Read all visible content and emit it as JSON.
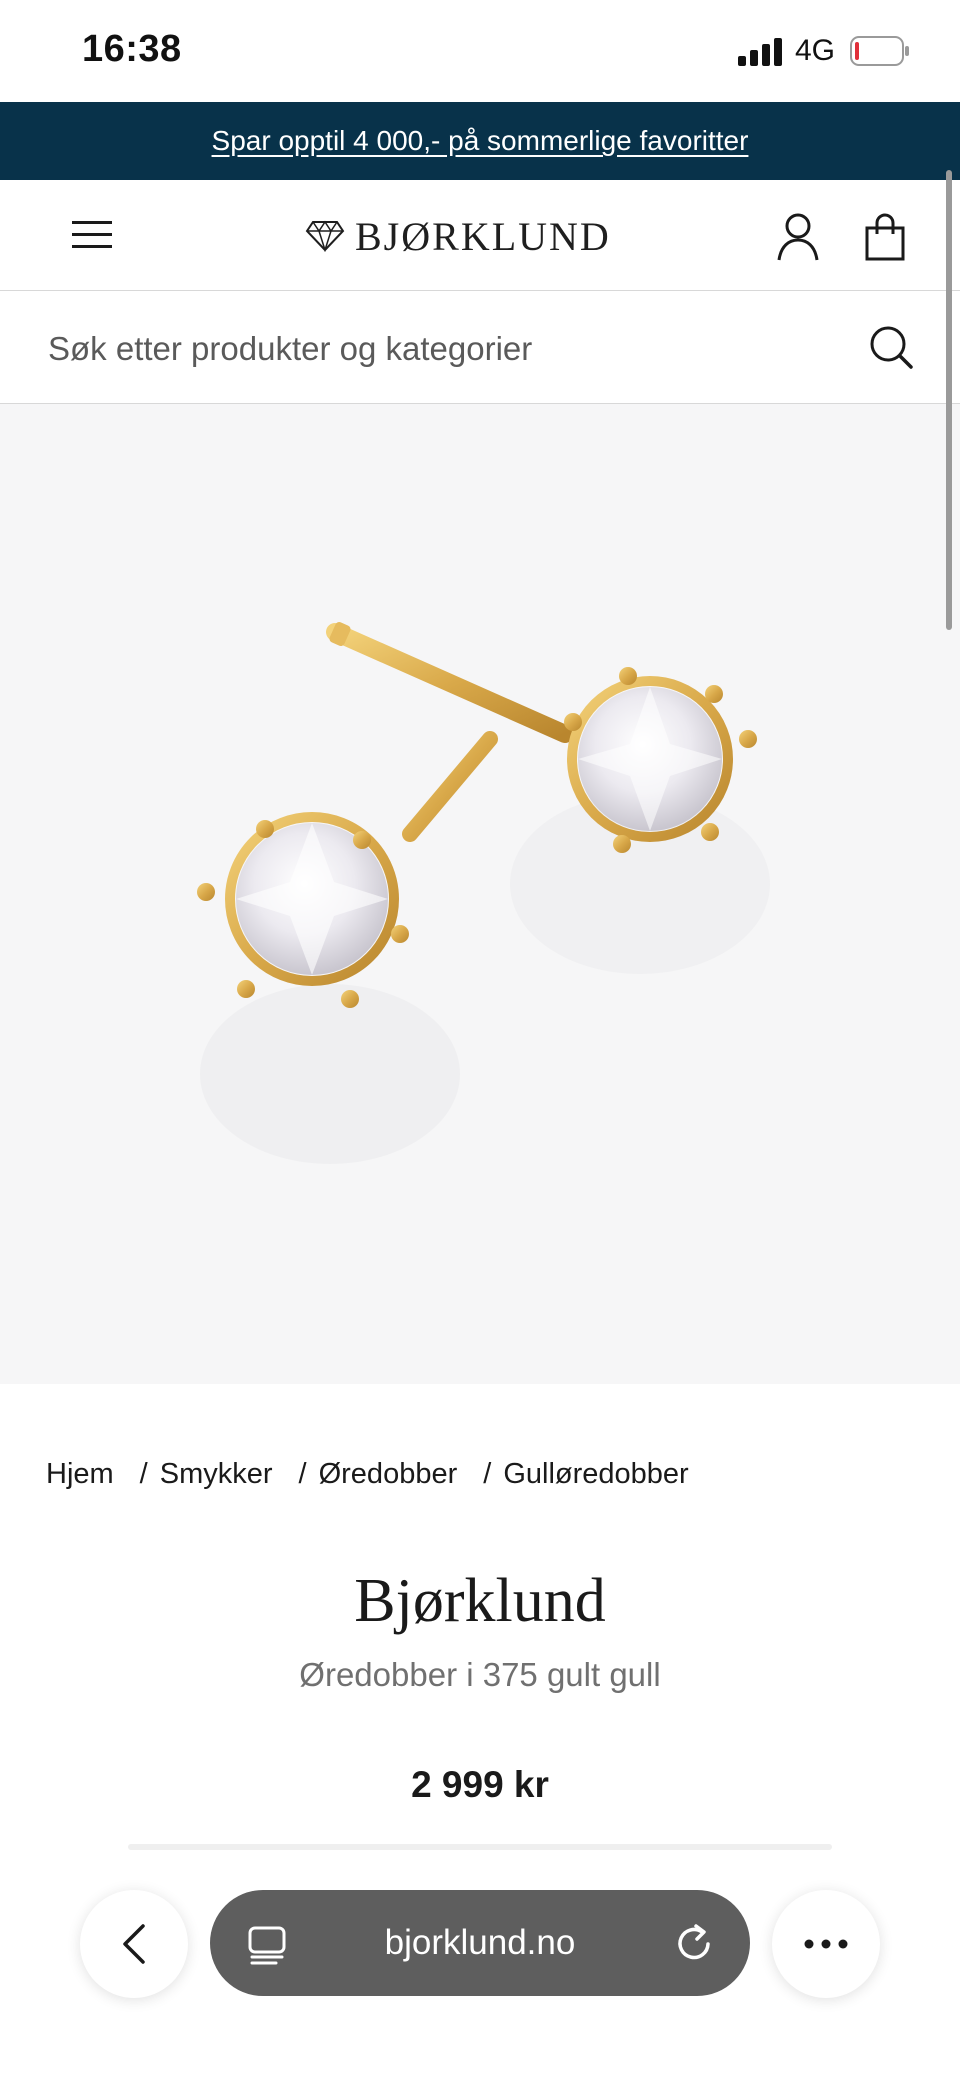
{
  "status_bar": {
    "time": "16:38",
    "network": "4G",
    "battery_icon": "battery-low-icon",
    "signal_icon": "cellular-signal-icon"
  },
  "promo": {
    "text": "Spar opptil 4 000,- på sommerlige favoritter",
    "background": "#08324a"
  },
  "header": {
    "brand": "BJØRKLUND",
    "menu_icon": "hamburger-menu-icon",
    "account_icon": "user-icon",
    "cart_icon": "shopping-bag-icon"
  },
  "search": {
    "placeholder": "Søk etter produkter og kategorier",
    "icon": "search-icon"
  },
  "product_image": {
    "alt": "Øredobber i 375 gult gull",
    "metal_color": "#d9a94a"
  },
  "breadcrumb": [
    {
      "label": "Hjem"
    },
    {
      "label": "Smykker"
    },
    {
      "label": "Øredobber"
    },
    {
      "label": "Gulløredobber"
    }
  ],
  "product": {
    "brand": "Bjørklund",
    "name": "Øredobber i 375 gult gull",
    "price": "2 999 kr"
  },
  "browser": {
    "url": "bjorklund.no",
    "back_icon": "chevron-left-icon",
    "tabs_icon": "tabs-icon",
    "reload_icon": "reload-icon",
    "more_icon": "more-dots-icon"
  }
}
